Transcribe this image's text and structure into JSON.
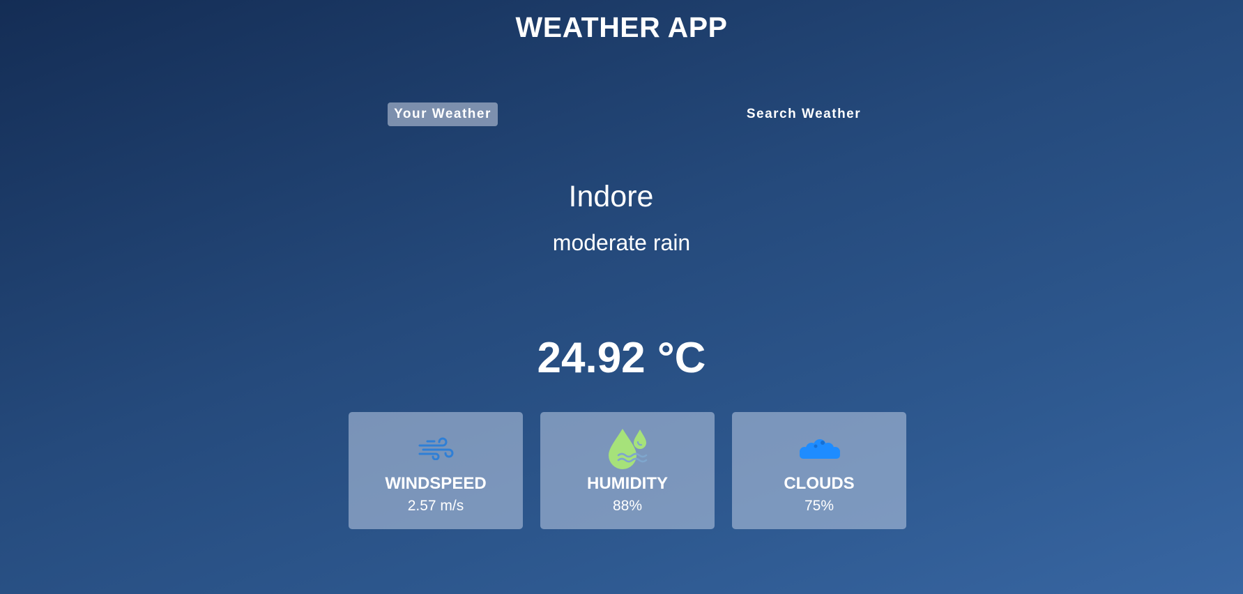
{
  "app": {
    "title": "WEATHER APP"
  },
  "tabs": [
    {
      "label": "Your Weather",
      "active": true
    },
    {
      "label": "Search Weather",
      "active": false
    }
  ],
  "weather": {
    "city": "Indore",
    "description": "moderate rain",
    "temperature": "24.92 °C"
  },
  "cards": [
    {
      "icon": "wind-icon",
      "label": "WINDSPEED",
      "value": "2.57 m/s"
    },
    {
      "icon": "humidity-icon",
      "label": "HUMIDITY",
      "value": "88%"
    },
    {
      "icon": "clouds-icon",
      "label": "CLOUDS",
      "value": "75%"
    }
  ],
  "colors": {
    "background_top": "#142d55",
    "background_bottom": "#3866a2",
    "card_background": "#adbeda",
    "active_tab_background": "#dbe2ef",
    "wind_icon": "#2f7fd6",
    "humidity_icon": "#a6e27a",
    "clouds_icon": "#1e8cff"
  }
}
